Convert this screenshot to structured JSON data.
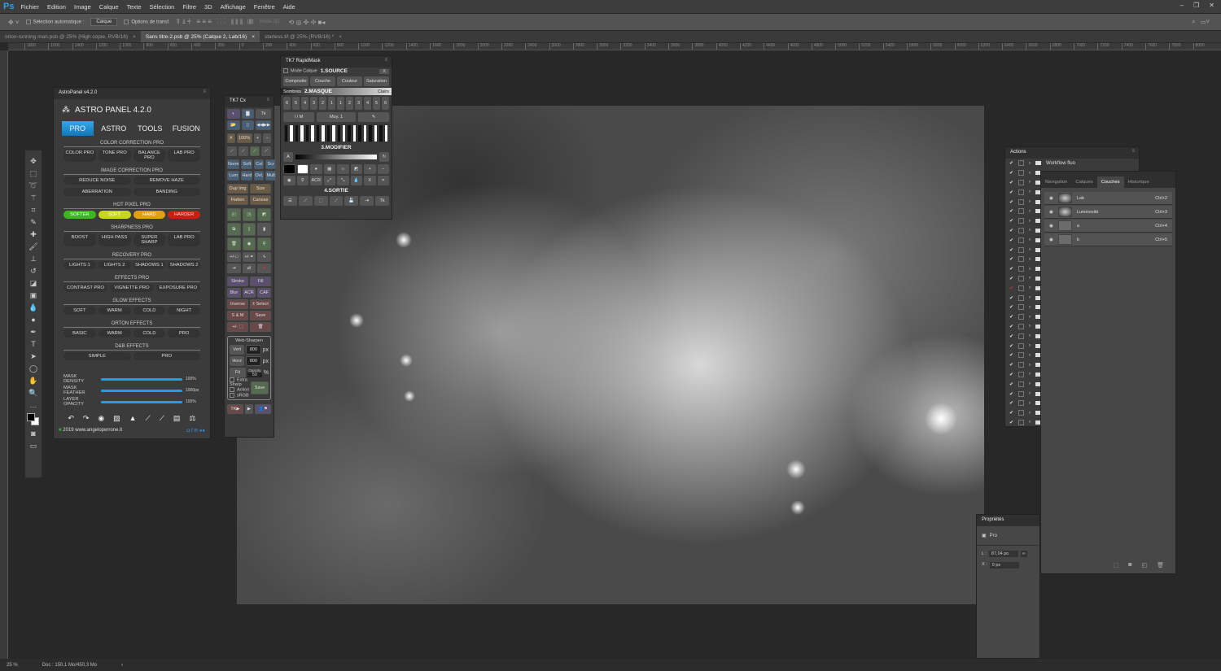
{
  "menubar": {
    "logo": "Ps",
    "items": [
      "Fichier",
      "Edition",
      "Image",
      "Calque",
      "Texte",
      "Sélection",
      "Filtre",
      "3D",
      "Affichage",
      "Fenêtre",
      "Aide"
    ]
  },
  "options": {
    "auto_select_label": "Sélection automatique :",
    "auto_select_value": "Calque",
    "transform_label": "Options de transf.",
    "mode3d": "Mode 3D :"
  },
  "tabs": [
    {
      "label": "orion-running man.psb @ 25% (High copie, RVB/16)",
      "close": "×"
    },
    {
      "label": "Sans titre-2.psb @ 25% (Calque 2, Lab/16)",
      "close": "×"
    },
    {
      "label": "starless.tif @ 25% (RVB/16) *",
      "close": "×"
    }
  ],
  "ruler": [
    "1800",
    "1600",
    "1400",
    "1200",
    "1000",
    "800",
    "600",
    "400",
    "200",
    "0",
    "200",
    "400",
    "600",
    "800",
    "1000",
    "1200",
    "1400",
    "1600",
    "1800",
    "2000",
    "2200",
    "2400",
    "2600",
    "2800",
    "3000",
    "3200",
    "3400",
    "3600",
    "3800",
    "4000",
    "4200",
    "4400",
    "4600",
    "4800",
    "5000",
    "5200",
    "5400",
    "5600",
    "5800",
    "6000",
    "6200",
    "6400",
    "6600",
    "6800",
    "7000",
    "7200",
    "7400",
    "7600",
    "7800",
    "8000"
  ],
  "status": {
    "zoom": "25 %",
    "doc": "Doc : 150,1 Mo/450,3 Mo",
    "arrow": "›"
  },
  "astro": {
    "tab_title": "AstroPanel v4.2.0",
    "title": "ASTRO PANEL 4.2.0",
    "tabs": [
      "PRO",
      "ASTRO",
      "TOOLS",
      "FUSION"
    ],
    "sections": [
      {
        "title": "COLOR CORRECTION PRO",
        "rows": [
          [
            "COLOR PRO",
            "TONE PRO",
            "BALANCE PRO",
            "LAB PRO"
          ]
        ]
      },
      {
        "title": "IMAGE CORRECTION PRO",
        "rows": [
          [
            "REDUCE NOISE",
            "REMOVE HAZE"
          ],
          [
            "ABERRATION",
            "BANDING"
          ]
        ]
      },
      {
        "title": "HOT PIXEL PRO",
        "rows": [
          [
            "SOFTER",
            "SOFT",
            "HARD",
            "HARDER"
          ]
        ]
      },
      {
        "title": "SHARPNESS PRO",
        "rows": [
          [
            "BOOST",
            "HIGH PASS",
            "SUPER SHARP",
            "LAB PRO"
          ]
        ]
      },
      {
        "title": "RECOVERY PRO",
        "rows": [
          [
            "LIGHTS 1",
            "LIGHTS 2",
            "SHADOWS 1",
            "SHADOWS 2"
          ]
        ]
      },
      {
        "title": "EFFECTS PRO",
        "rows": [
          [
            "CONTRAST PRO",
            "VIGNETTE PRO",
            "EXPOSURE PRO"
          ]
        ]
      },
      {
        "title": "GLOW EFFECTS",
        "rows": [
          [
            "SOFT",
            "WARM",
            "COLD",
            "NIGHT"
          ]
        ]
      },
      {
        "title": "ORTON EFFECTS",
        "rows": [
          [
            "BASIC",
            "WARM",
            "COLD",
            "PRO"
          ]
        ]
      },
      {
        "title": "D&B EFFECTS",
        "rows": [
          [
            "SIMPLE",
            "PRO"
          ]
        ]
      }
    ],
    "hotpixel_colors": [
      "#3cb81e",
      "#c8d818",
      "#e0a010",
      "#c82010"
    ],
    "sliders": [
      {
        "label": "MASK DENSITY",
        "value": "100%",
        "fraction": 1
      },
      {
        "label": "MASK FEATHER",
        "value": "1000px",
        "fraction": 1
      },
      {
        "label": "LAYER OPACITY",
        "value": "100%",
        "fraction": 1
      }
    ],
    "footer": "2019 www.angeloperrone.it"
  },
  "tk7": {
    "title": "TK7 Cx",
    "buttons": [
      "Norm",
      "Soft",
      "Col",
      "Scr",
      "Lum",
      "Hard",
      "OvL",
      "Mult",
      "Dup Img",
      "Size",
      "Flatten",
      "Canvas",
      "Stroke",
      "Fill",
      "Blur",
      "ACR",
      "CAF",
      "Inverse",
      "± Select",
      "S & M",
      "Save"
    ],
    "zoom": "100%",
    "websharpen": {
      "title": "Web-Sharpen",
      "vert": "Vert",
      "horz": "Horz",
      "vert_val": "800",
      "horz_val": "800",
      "unit": "px",
      "fit": "Fit",
      "opacity_label": "Opacity",
      "opacity": "50",
      "pct": "%",
      "extra": "Extra Sharp",
      "action": "Action",
      "srgb": "sRGB",
      "save": "Save"
    },
    "tk": "TK"
  },
  "rapid": {
    "title": "TK7 RapidMask",
    "mode": "Mode Calque",
    "source": "1.SOURCE",
    "close": "X",
    "source_btns": [
      "Composite",
      "Couche",
      "Couleur",
      "Saturation"
    ],
    "masque": "2.MASQUE",
    "sombres": "Sombres",
    "clairs": "Clairs",
    "nums": [
      "6",
      "5",
      "4",
      "3",
      "2",
      "1",
      "1",
      "2",
      "3",
      "4",
      "5",
      "6"
    ],
    "im": "I / M",
    "moy": "Moy. 1",
    "modifier": "3.MODIFIER",
    "a": "A",
    "acr": "ACR",
    "x": "X",
    "sortie": "4.SORTIE"
  },
  "actions": {
    "title": "Actions",
    "first": "Workflow fluo"
  },
  "layers": {
    "tabs": [
      "Navigation",
      "Calques",
      "Couches",
      "Historique"
    ],
    "channels": [
      {
        "name": "Lab",
        "shortcut": "Ctrl+2"
      },
      {
        "name": "Luminosité",
        "shortcut": "Ctrl+3"
      },
      {
        "name": "a",
        "shortcut": "Ctrl+4"
      },
      {
        "name": "b",
        "shortcut": "Ctrl+5"
      }
    ]
  },
  "props": {
    "title": "Propriétés",
    "pro": "Pro",
    "l_label": "L :",
    "l_value": "87,04 po",
    "x_label": "X :",
    "x_value": "0 px"
  }
}
